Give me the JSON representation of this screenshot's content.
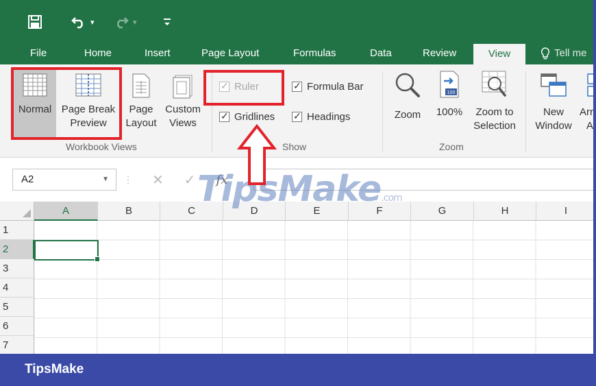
{
  "quick_access": {
    "save_icon": "save-icon",
    "undo_icon": "undo-icon",
    "redo_icon": "redo-icon",
    "customize_icon": "customize-icon"
  },
  "tabs": [
    "File",
    "Home",
    "Insert",
    "Page Layout",
    "Formulas",
    "Data",
    "Review",
    "View"
  ],
  "tell_me": "Tell me",
  "ribbon": {
    "workbook_views": {
      "label": "Workbook Views",
      "normal": "Normal",
      "page_break_1": "Page Break",
      "page_break_2": "Preview",
      "page_layout_1": "Page",
      "page_layout_2": "Layout",
      "custom_1": "Custom",
      "custom_2": "Views"
    },
    "show": {
      "label": "Show",
      "ruler": "Ruler",
      "formula_bar": "Formula Bar",
      "gridlines": "Gridlines",
      "headings": "Headings"
    },
    "zoom": {
      "label": "Zoom",
      "zoom": "Zoom",
      "hundred": "100%",
      "zoom_sel_1": "Zoom to",
      "zoom_sel_2": "Selection"
    },
    "window": {
      "new_1": "New",
      "new_2": "Window",
      "arrange_1": "Arr",
      "arrange_2": "A"
    }
  },
  "formula_bar": {
    "name_box": "A2",
    "cancel": "✕",
    "enter": "✓",
    "fx": "fx"
  },
  "columns": [
    "A",
    "B",
    "C",
    "D",
    "E",
    "F",
    "G",
    "H",
    "I"
  ],
  "rows": [
    "1",
    "2",
    "3",
    "4",
    "5",
    "6",
    "7"
  ],
  "watermark": {
    "text": "TipsMake",
    "suffix": ".com"
  },
  "footer": {
    "brand": "TipsMake"
  },
  "colors": {
    "excel_green": "#217346",
    "highlight_red": "#e2232b",
    "footer_blue": "#3a4aa6"
  }
}
